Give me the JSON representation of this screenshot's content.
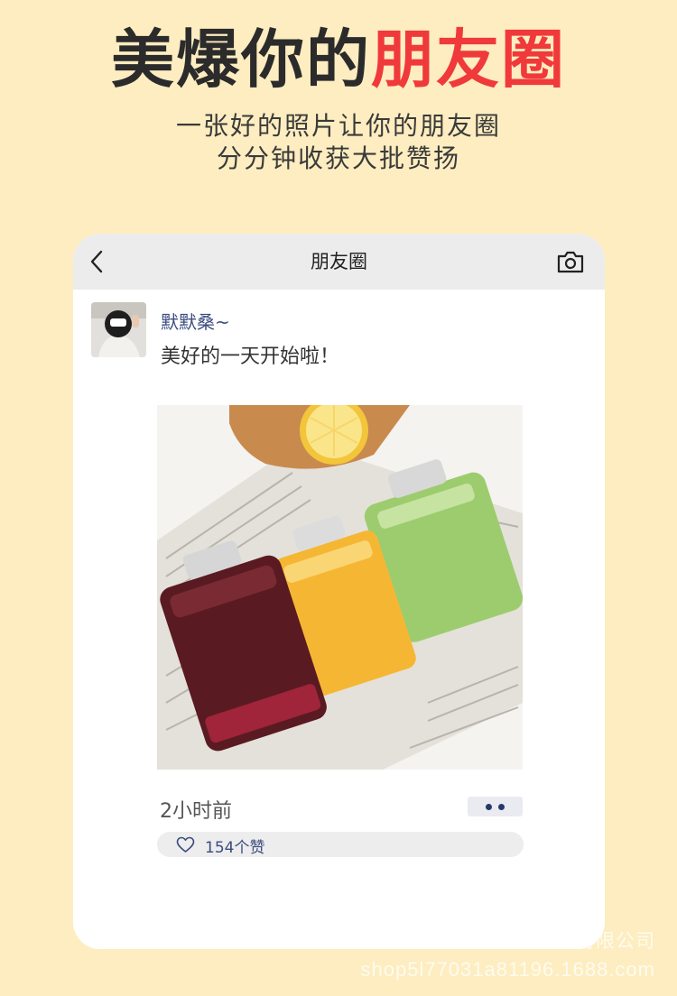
{
  "headline": {
    "part1": "美爆你的",
    "part2": "朋友圈"
  },
  "subtitle": {
    "line1": "一张好的照片让你的朋友圈",
    "line2": "分分钟收获大批赞扬"
  },
  "colors": {
    "background": "#fdedc0",
    "accent": "#f0393a",
    "username": "#3b4c80"
  },
  "nav": {
    "title": "朋友圈",
    "back_icon": "chevron-left-icon",
    "camera_icon": "camera-icon"
  },
  "post": {
    "username": "默默桑~",
    "text": "美好的一天开始啦！",
    "time": "2小时前",
    "likes": "154个赞"
  },
  "watermark": {
    "line1": "徐州福拉尔包装制品有限公司",
    "line2": "shop5l77031a81196.1688.com"
  }
}
